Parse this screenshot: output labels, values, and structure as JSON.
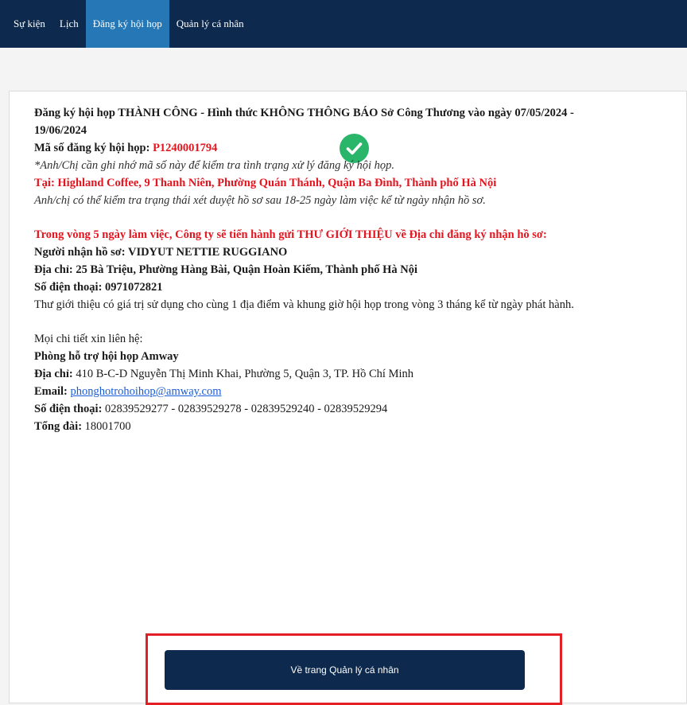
{
  "nav": {
    "items": [
      "Sự kiện",
      "Lịch",
      "Đăng ký hội họp",
      "Quản lý cá nhân"
    ],
    "active_index": 2
  },
  "status_icon": "check-circle-icon",
  "colors": {
    "nav_bg": "#0d2a4e",
    "nav_active": "#2578b5",
    "success": "#29b56a",
    "alert_red": "#e4151f",
    "link": "#1a5cd8"
  },
  "result": {
    "title": "Đăng ký hội họp THÀNH CÔNG - Hình thức KHÔNG THÔNG BÁO Sở Công Thương vào ngày 07/05/2024 - 19/06/2024",
    "code_label": "Mã số đăng ký hội họp:",
    "code_value": "P1240001794",
    "code_note": "*Anh/Chị cần ghi nhớ mã số này để kiểm tra tình trạng xử lý đăng ký hội họp.",
    "location": "Tại: Highland Coffee, 9 Thanh Niên, Phường Quán Thánh, Quận Ba Đình, Thành phố Hà Nội",
    "review_note": "Anh/chị có thể kiểm tra trạng thái xét duyệt hồ sơ sau 18-25 ngày làm việc kể từ ngày nhận hồ sơ."
  },
  "letter": {
    "notice": "Trong vòng 5 ngày làm việc, Công ty sẽ tiến hành gửi THƯ GIỚI THIỆU về Địa chỉ đăng ký nhận hồ sơ:",
    "recipient": "Người nhận hồ sơ: VIDYUT NETTIE RUGGIANO",
    "address": "Địa chỉ: 25 Bà Triệu, Phường Hàng Bài, Quận Hoàn Kiếm, Thành phố Hà Nội",
    "phone": "Số điện thoại: 0971072821",
    "validity": "Thư giới thiệu có giá trị sử dụng cho cùng 1 địa điểm và khung giờ hội họp trong vòng 3 tháng kể từ ngày phát hành."
  },
  "contact": {
    "intro": "Mọi chi tiết xin liên hệ:",
    "dept": "Phòng hỗ trợ hội họp Amway",
    "address_label": "Địa chỉ:",
    "address_value": "410 B-C-D Nguyễn Thị Minh Khai, Phường 5, Quận 3, TP. Hồ Chí Minh",
    "email_label": "Email:",
    "email_value": "phonghotrohoihop@amway.com",
    "phone_label": "Số điện thoại:",
    "phone_value": "02839529277 - 02839529278 - 02839529240 - 02839529294",
    "hotline_label": "Tổng đài:",
    "hotline_value": "18001700"
  },
  "button": {
    "label": "Về trang Quản lý cá nhân"
  }
}
